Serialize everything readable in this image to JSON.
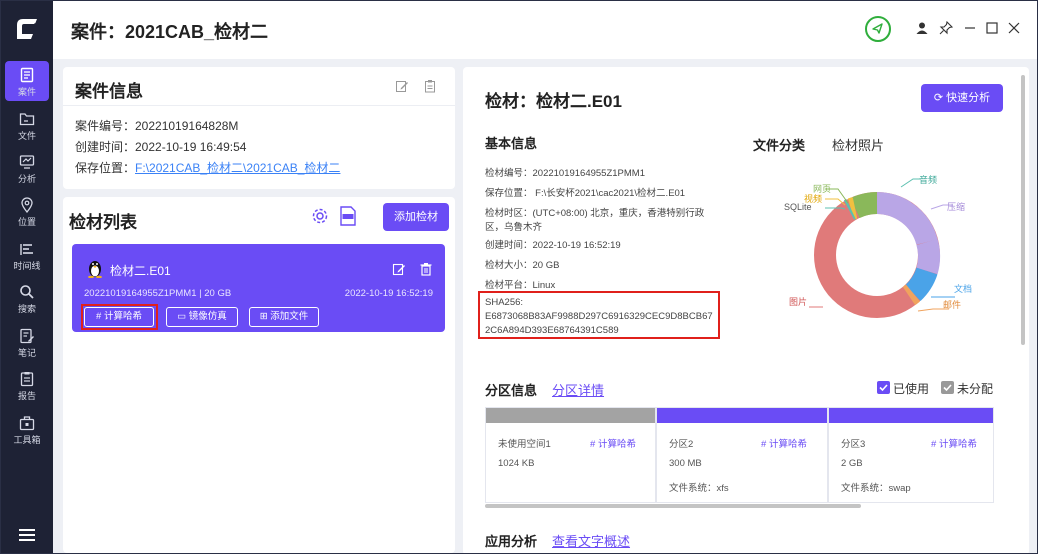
{
  "app": {
    "title": "案件：2021CAB_检材二"
  },
  "sidebar": {
    "items": [
      {
        "label": "案件"
      },
      {
        "label": "文件"
      },
      {
        "label": "分析"
      },
      {
        "label": "位置"
      },
      {
        "label": "时间线"
      },
      {
        "label": "搜索"
      },
      {
        "label": "笔记"
      },
      {
        "label": "报告"
      },
      {
        "label": "工具箱"
      }
    ]
  },
  "case_info": {
    "title": "案件信息",
    "number": "案件编号：20221019164828M",
    "created": "创建时间：2022-10-19 16:49:54",
    "location_label": "保存位置：",
    "location_value": "F:\\2021CAB_检材二\\2021CAB_检材二"
  },
  "evidence_list": {
    "title": "检材列表",
    "add_button": "添加检材",
    "item": {
      "name": "检材二.E01",
      "meta": "20221019164955Z1PMM1 | 20 GB",
      "time": "2022-10-19 16:52:19",
      "btn_hash": "计算哈希",
      "btn_mirror": "镜像仿真",
      "btn_addfile": "添加文件"
    }
  },
  "detail": {
    "title": "检材：检材二.E01",
    "quick_analysis": "快速分析",
    "basic_title": "基本信息",
    "lines": [
      "检材编号：20221019164955Z1PMM1",
      "保存位置：  F:\\长安杯2021\\cac2021\\检材二.E01",
      "检材时区：(UTC+08:00) 北京，重庆，香港特别行政",
      "区，乌鲁木齐",
      "创建时间：2022-10-19 16:52:19",
      "检材大小：20 GB",
      "检材平台：Linux"
    ],
    "sha_label": "SHA256:",
    "sha1": "E6873068B83AF9988D297C6916329CEC9D8BCB67",
    "sha2": "2C6A894D393E68764391C589",
    "tabs": {
      "file_class": "文件分类",
      "photos": "检材照片"
    },
    "legend": {
      "web": "网页",
      "video": "视频",
      "sqlite": "SQLite",
      "audio": "音频",
      "zip": "压缩",
      "doc": "文档",
      "mail": "邮件",
      "image": "图片"
    },
    "partition": {
      "title": "分区信息",
      "detail_link": "分区详情",
      "used": "已使用",
      "unallocated": "未分配",
      "cols": [
        {
          "name": "未使用空间1",
          "hash": "计算哈希",
          "size": "1024 KB",
          "fs": ""
        },
        {
          "name": "分区2",
          "hash": "计算哈希",
          "size": "300 MB",
          "fs": "文件系统：xfs"
        },
        {
          "name": "分区3",
          "hash": "计算哈希",
          "size": "2 GB",
          "fs": "文件系统：swap"
        }
      ]
    },
    "app_analysis": {
      "title": "应用分析",
      "link": "查看文字概述"
    }
  },
  "colors": {
    "accent": "#6a4cf5",
    "sidebar": "#1e2235",
    "donut": {
      "image": "#e07a7a",
      "zip": "#b9a6e6",
      "doc": "#4aa3e8",
      "mail": "#f0a35e",
      "web": "#8ab85a",
      "video": "#f0c040",
      "audio": "#5cc0b0"
    }
  }
}
